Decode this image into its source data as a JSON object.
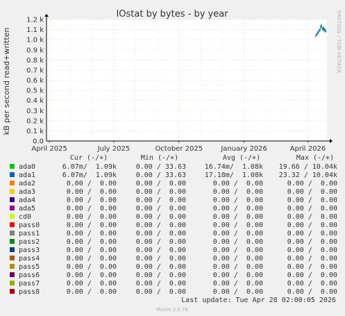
{
  "chart_data": {
    "type": "line",
    "title": "IOstat by bytes - by year",
    "ylabel": "kB per second read+written",
    "xlabel": "",
    "side_label": "RRDTOOL / TOBI OETIKER",
    "footer": "Munin 2.0.76",
    "last_update": "Last update:  Tue Apr 28 02:00:05 2026",
    "ylim": [
      0,
      1200
    ],
    "y_ticks": [
      {
        "value": 0,
        "label": "0.0"
      },
      {
        "value": 100,
        "label": "0.1 k"
      },
      {
        "value": 200,
        "label": "0.2 k"
      },
      {
        "value": 300,
        "label": "0.3 k"
      },
      {
        "value": 400,
        "label": "0.4 k"
      },
      {
        "value": 500,
        "label": "0.5 k"
      },
      {
        "value": 600,
        "label": "0.6 k"
      },
      {
        "value": 700,
        "label": "0.7 k"
      },
      {
        "value": 800,
        "label": "0.8 k"
      },
      {
        "value": 900,
        "label": "0.9 k"
      },
      {
        "value": 1000,
        "label": "1.0 k"
      },
      {
        "value": 1100,
        "label": "1.1 k"
      },
      {
        "value": 1200,
        "label": "1.2 k"
      }
    ],
    "xlim": [
      "2025-03-28",
      "2026-04-28"
    ],
    "x_ticks": [
      {
        "date": "2025-04-01",
        "label": "April 2025"
      },
      {
        "date": "2025-07-01",
        "label": "July 2025"
      },
      {
        "date": "2025-10-01",
        "label": "October 2025"
      },
      {
        "date": "2026-01-01",
        "label": "January 2026"
      },
      {
        "date": "2026-04-01",
        "label": "April 2026"
      }
    ],
    "columns": [
      "Cur (-/+)",
      "Min (-/+)",
      "Avg (-/+)",
      "Max (-/+)"
    ],
    "series": [
      {
        "name": "ada0",
        "color": "#00cc00",
        "cur": "6.07m/  1.09k",
        "min": "0.00 / 33.63",
        "avg": "16.74m/  1.08k",
        "max": "19.66 / 10.04k",
        "points": [
          [
            "2026-04-12",
            1030
          ],
          [
            "2026-04-13",
            1060
          ],
          [
            "2026-04-14",
            1050
          ],
          [
            "2026-04-15",
            1080
          ],
          [
            "2026-04-16",
            1070
          ],
          [
            "2026-04-17",
            1100
          ],
          [
            "2026-04-18",
            1090
          ],
          [
            "2026-04-19",
            1130
          ],
          [
            "2026-04-20",
            1150
          ],
          [
            "2026-04-21",
            1120
          ],
          [
            "2026-04-22",
            1100
          ],
          [
            "2026-04-23",
            1130
          ],
          [
            "2026-04-24",
            1090
          ],
          [
            "2026-04-25",
            1110
          ],
          [
            "2026-04-26",
            1080
          ],
          [
            "2026-04-27",
            1095
          ]
        ]
      },
      {
        "name": "ada1",
        "color": "#0066b3",
        "cur": "6.07m/  1.09k",
        "min": "0.00 / 33.63",
        "avg": "17.18m/  1.08k",
        "max": "23.32 / 10.04k",
        "points": [
          [
            "2026-04-12",
            1025
          ],
          [
            "2026-04-13",
            1055
          ],
          [
            "2026-04-14",
            1045
          ],
          [
            "2026-04-15",
            1075
          ],
          [
            "2026-04-16",
            1065
          ],
          [
            "2026-04-17",
            1095
          ],
          [
            "2026-04-18",
            1085
          ],
          [
            "2026-04-19",
            1125
          ],
          [
            "2026-04-20",
            1145
          ],
          [
            "2026-04-21",
            1115
          ],
          [
            "2026-04-22",
            1095
          ],
          [
            "2026-04-23",
            1125
          ],
          [
            "2026-04-24",
            1085
          ],
          [
            "2026-04-25",
            1105
          ],
          [
            "2026-04-26",
            1075
          ],
          [
            "2026-04-27",
            1090
          ]
        ]
      },
      {
        "name": "ada2",
        "color": "#ff8000",
        "cur": "0.00 /  0.00",
        "min": "0.00 /  0.00",
        "avg": "0.00 /  0.00",
        "max": "0.00 /  0.00"
      },
      {
        "name": "ada3",
        "color": "#ffcc00",
        "cur": "0.00 /  0.00",
        "min": "0.00 /  0.00",
        "avg": "0.00 /  0.00",
        "max": "0.00 /  0.00"
      },
      {
        "name": "ada4",
        "color": "#330099",
        "cur": "0.00 /  0.00",
        "min": "0.00 /  0.00",
        "avg": "0.00 /  0.00",
        "max": "0.00 /  0.00"
      },
      {
        "name": "ada5",
        "color": "#990099",
        "cur": "0.00 /  0.00",
        "min": "0.00 /  0.00",
        "avg": "0.00 /  0.00",
        "max": "0.00 /  0.00"
      },
      {
        "name": "cd0",
        "color": "#ccff00",
        "cur": "0.00 /  0.00",
        "min": "0.00 /  0.00",
        "avg": "0.00 /  0.00",
        "max": "0.00 /  0.00"
      },
      {
        "name": "pass0",
        "color": "#ff0000",
        "cur": "0.00 /  0.00",
        "min": "0.00 /  0.00",
        "avg": "0.00 /  0.00",
        "max": "0.00 /  0.00"
      },
      {
        "name": "pass1",
        "color": "#808080",
        "cur": "0.00 /  0.00",
        "min": "0.00 /  0.00",
        "avg": "0.00 /  0.00",
        "max": "0.00 /  0.00"
      },
      {
        "name": "pass2",
        "color": "#008f00",
        "cur": "0.00 /  0.00",
        "min": "0.00 /  0.00",
        "avg": "0.00 /  0.00",
        "max": "0.00 /  0.00"
      },
      {
        "name": "pass3",
        "color": "#00487d",
        "cur": "0.00 /  0.00",
        "min": "0.00 /  0.00",
        "avg": "0.00 /  0.00",
        "max": "0.00 /  0.00"
      },
      {
        "name": "pass4",
        "color": "#b35a00",
        "cur": "0.00 /  0.00",
        "min": "0.00 /  0.00",
        "avg": "0.00 /  0.00",
        "max": "0.00 /  0.00"
      },
      {
        "name": "pass5",
        "color": "#b38f00",
        "cur": "0.00 /  0.00",
        "min": "0.00 /  0.00",
        "avg": "0.00 /  0.00",
        "max": "0.00 /  0.00"
      },
      {
        "name": "pass6",
        "color": "#6b006b",
        "cur": "0.00 /  0.00",
        "min": "0.00 /  0.00",
        "avg": "0.00 /  0.00",
        "max": "0.00 /  0.00"
      },
      {
        "name": "pass7",
        "color": "#8fb300",
        "cur": "0.00 /  0.00",
        "min": "0.00 /  0.00",
        "avg": "0.00 /  0.00",
        "max": "0.00 /  0.00"
      },
      {
        "name": "pass8",
        "color": "#b30000",
        "cur": "0.00 /  0.00",
        "min": "0.00 /  0.00",
        "avg": "0.00 /  0.00",
        "max": "0.00 /  0.00"
      }
    ],
    "grid": true,
    "colors": {
      "background": "#f0f0f0",
      "plot_bg": "#ffffff",
      "grid": "#f5bcbc",
      "axis": "#000000",
      "text": "#333333"
    }
  }
}
